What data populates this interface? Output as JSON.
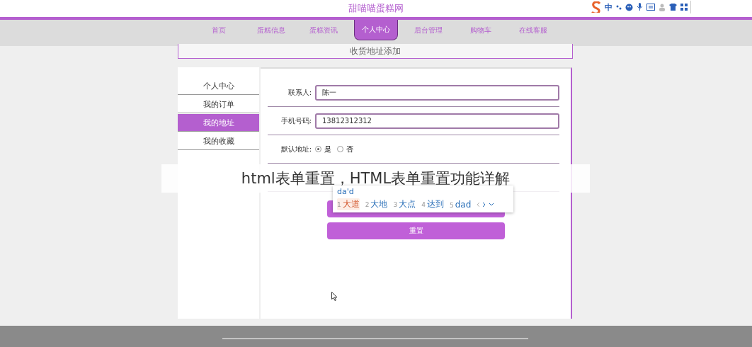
{
  "site_title": "甜喵喵蛋糕网",
  "ime_toolbar": {
    "mode": "中"
  },
  "nav": [
    {
      "label": "首页",
      "selected": false
    },
    {
      "label": "蛋糕信息",
      "selected": false
    },
    {
      "label": "蛋糕资讯",
      "selected": false
    },
    {
      "label": "个人中心",
      "selected": true
    },
    {
      "label": "后台管理",
      "selected": false
    },
    {
      "label": "购物车",
      "selected": false
    },
    {
      "label": "在线客服",
      "selected": false
    }
  ],
  "page_heading": "收货地址添加",
  "sidebar": [
    {
      "label": "个人中心",
      "selected": false
    },
    {
      "label": "我的订单",
      "selected": false
    },
    {
      "label": "我的地址",
      "selected": true
    },
    {
      "label": "我的收藏",
      "selected": false
    }
  ],
  "form": {
    "rows": [
      {
        "kind": "text",
        "label": "联系人:",
        "value": "陈一"
      },
      {
        "kind": "text",
        "label": "手机号码:",
        "value": "13812312312"
      },
      {
        "kind": "radio",
        "label": "默认地址:",
        "options": [
          {
            "label": "是",
            "selected": true
          },
          {
            "label": "否",
            "selected": false
          }
        ]
      },
      {
        "kind": "blank"
      }
    ],
    "buttons": [
      {
        "kind": "covered"
      },
      {
        "kind": "labeled",
        "label": "重置"
      }
    ]
  },
  "ime_popup": {
    "composition": "da'd",
    "candidates": [
      {
        "number": "1",
        "text": "大道",
        "selected": true
      },
      {
        "number": "2",
        "text": "大地",
        "selected": false
      },
      {
        "number": "3",
        "text": "大点",
        "selected": false
      },
      {
        "number": "4",
        "text": "达到",
        "selected": false
      },
      {
        "number": "5",
        "text": "dad",
        "selected": false
      }
    ]
  },
  "caption_banner": "html表单重置，HTML表单重置功能详解"
}
